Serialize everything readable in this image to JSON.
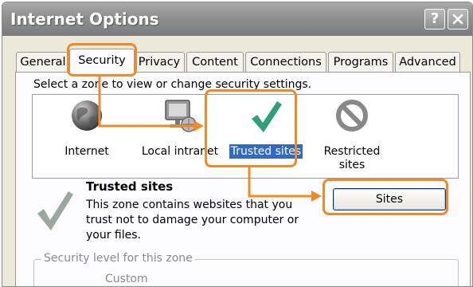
{
  "window": {
    "title": "Internet Options",
    "help_glyph": "?",
    "icons": {
      "help": "help-icon",
      "close": "close-icon"
    }
  },
  "tabs": [
    {
      "label": "General",
      "active": false
    },
    {
      "label": "Security",
      "active": true
    },
    {
      "label": "Privacy",
      "active": false
    },
    {
      "label": "Content",
      "active": false
    },
    {
      "label": "Connections",
      "active": false
    },
    {
      "label": "Programs",
      "active": false
    },
    {
      "label": "Advanced",
      "active": false
    }
  ],
  "security": {
    "instruction": "Select a zone to view or change security settings.",
    "zones": [
      {
        "label": "Internet",
        "icon": "globe-icon",
        "selected": false
      },
      {
        "label": "Local intranet",
        "icon": "computer-icon",
        "selected": false
      },
      {
        "label": "Trusted sites",
        "icon": "checkmark-icon",
        "selected": true
      },
      {
        "label": "Restricted sites",
        "icon": "prohibited-icon",
        "selected": false
      }
    ],
    "selected_zone": {
      "icon": "checkmark-icon",
      "title": "Trusted sites",
      "description": "This zone contains websites that you trust not to damage your computer or your files."
    },
    "sites_button": "Sites",
    "level_group_label": "Security level for this zone",
    "level_value": "Custom"
  },
  "colors": {
    "highlight": "#f08a24",
    "selection": "#316ac5",
    "checkmark": "#2f9e7a",
    "titlebar": "#8f8f8f"
  }
}
